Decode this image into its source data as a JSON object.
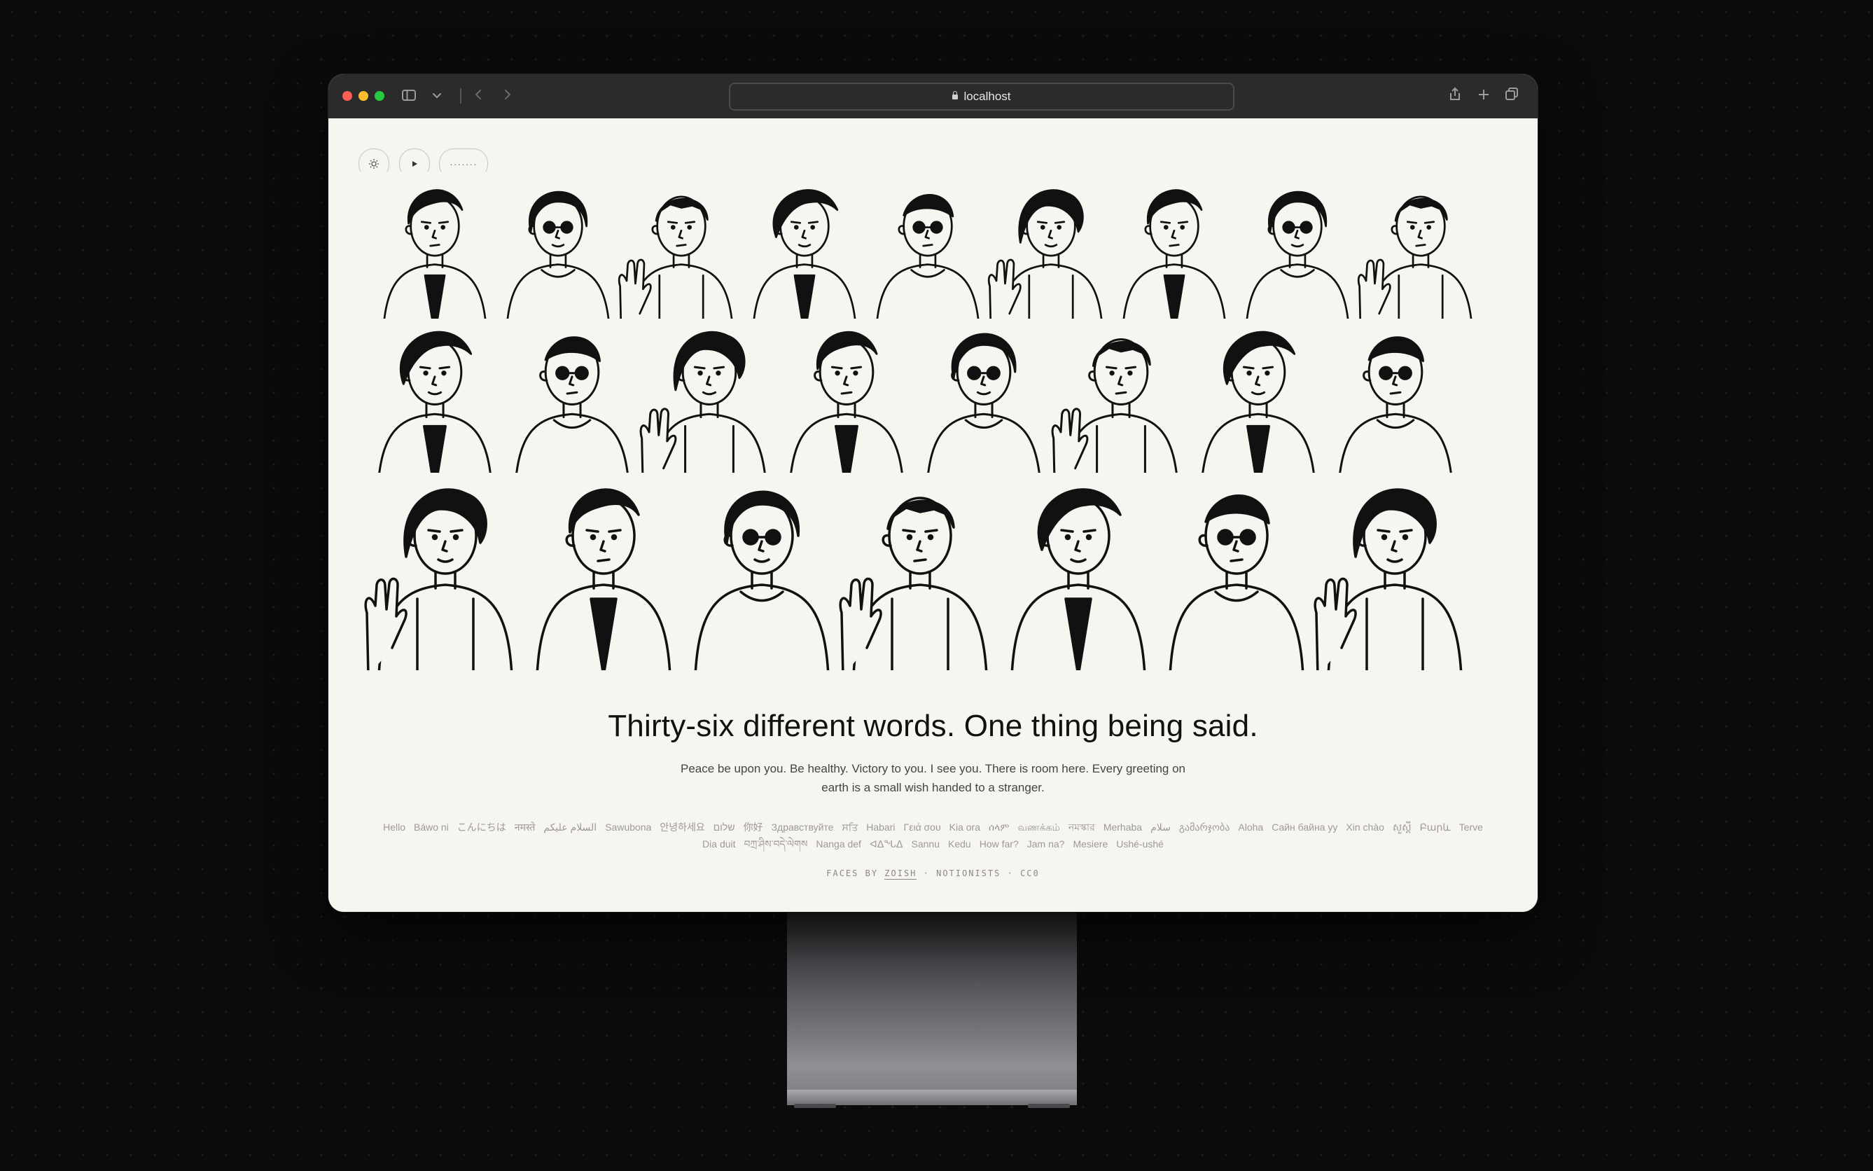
{
  "browser": {
    "url": "localhost",
    "traffic_lights": [
      "close",
      "minimize",
      "zoom"
    ],
    "icons": [
      "sidebar-icon",
      "chevron-down-icon",
      "back-icon",
      "forward-icon",
      "share-icon",
      "new-tab-icon",
      "tabs-overview-icon"
    ]
  },
  "controls": {
    "theme_icon": "sun-icon",
    "play_icon": "play-icon",
    "more_label": "·······"
  },
  "hero": {
    "headline": "Thirty-six different words. One thing being said.",
    "subtext": "Peace be upon you. Be healthy. Victory to you. I see you. There is room here. Every greeting on earth is a small wish handed to a stranger."
  },
  "greetings": [
    "Hello",
    "Báwo ni",
    "こんにちは",
    "नमस्ते",
    "السلام عليكم",
    "Sawubona",
    "안녕하세요",
    "שלום",
    "你好",
    "Здравствуйте",
    "ਸਤਿ",
    "Habari",
    "Γειά σου",
    "Kia ora",
    "ሰላም",
    "வணக்கம்",
    "নমস্কার",
    "Merhaba",
    "سلام",
    "გამარჯობა",
    "Aloha",
    "Сайн байна уу",
    "Xin chào",
    "សួស្តី",
    "Բարև",
    "Terve",
    "Dia duit",
    "བཀྲ་ཤིས་བདེ་ལེགས",
    "Nanga def",
    "ᐊᐃᖓᐃ",
    "Sannu",
    "Kedu",
    "How far?",
    "Jam na?",
    "Mesiere",
    "Ushé-ushé"
  ],
  "credits": {
    "prefix": "FACES BY",
    "author": "ZOISH",
    "sep1": "·",
    "source": "NOTIONISTS",
    "sep2": "·",
    "license": "CC0"
  },
  "colors": {
    "page_bg": "#f7f5f0",
    "ink": "#111111",
    "titlebar": "#2c2b2c",
    "desktop": "#0b0b0b"
  }
}
